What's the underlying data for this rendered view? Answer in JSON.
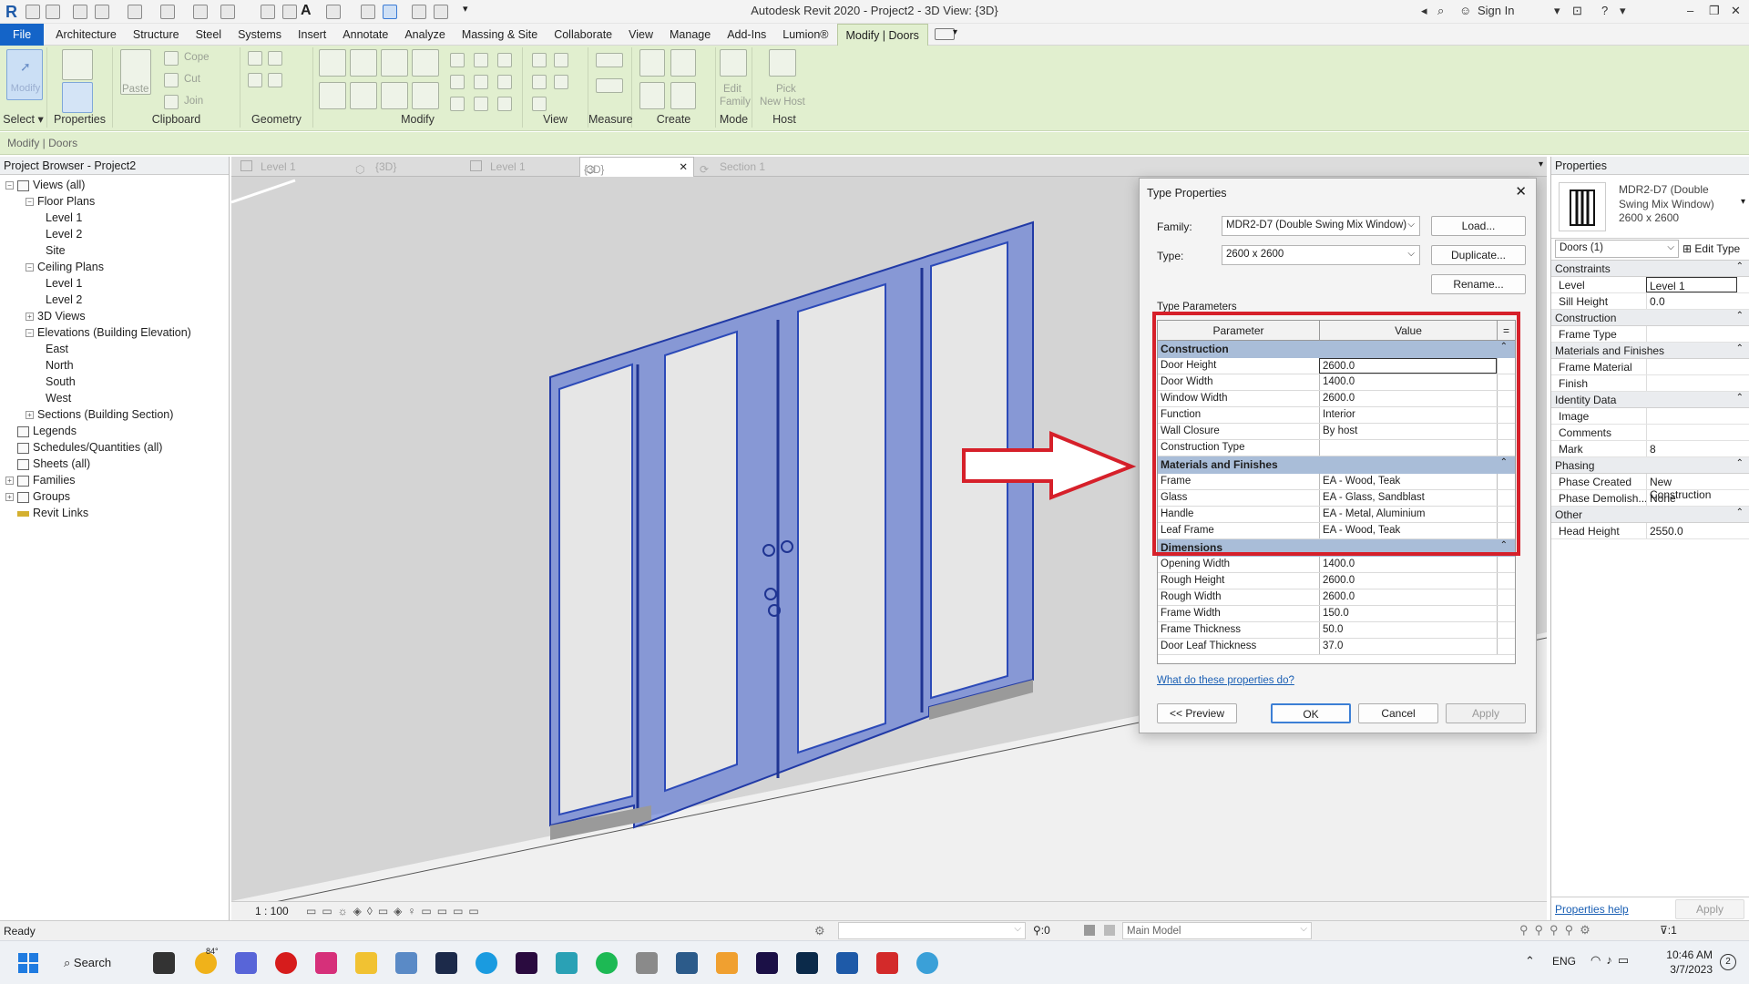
{
  "window": {
    "title": "Autodesk Revit 2020 - Project2 - 3D View: {3D}",
    "sign_in": "Sign In"
  },
  "menu": [
    "File",
    "Architecture",
    "Structure",
    "Steel",
    "Systems",
    "Insert",
    "Annotate",
    "Analyze",
    "Massing & Site",
    "Collaborate",
    "View",
    "Manage",
    "Add-Ins",
    "Lumion®",
    "Modify | Doors"
  ],
  "ribbon": {
    "groups": [
      "Select",
      "Properties",
      "Clipboard",
      "Geometry",
      "Modify",
      "View",
      "Measure",
      "Create",
      "Mode",
      "Host"
    ],
    "buttons": {
      "modify": "Modify",
      "paste": "Paste",
      "cope": "Cope",
      "cut": "Cut",
      "join": "Join",
      "edit_family_1": "Edit",
      "edit_family_2": "Family",
      "pick_host_1": "Pick",
      "pick_host_2": "New Host"
    }
  },
  "context_bar": "Modify | Doors",
  "project_browser": {
    "title": "Project Browser - Project2",
    "items": [
      {
        "label": "Views (all)",
        "level": 0,
        "toggle": "-"
      },
      {
        "label": "Floor Plans",
        "level": 1,
        "toggle": "-"
      },
      {
        "label": "Level 1",
        "level": 2
      },
      {
        "label": "Level 2",
        "level": 2
      },
      {
        "label": "Site",
        "level": 2
      },
      {
        "label": "Ceiling Plans",
        "level": 1,
        "toggle": "-"
      },
      {
        "label": "Level 1",
        "level": 2
      },
      {
        "label": "Level 2",
        "level": 2
      },
      {
        "label": "3D Views",
        "level": 1,
        "toggle": "+"
      },
      {
        "label": "Elevations (Building Elevation)",
        "level": 1,
        "toggle": "-"
      },
      {
        "label": "East",
        "level": 2
      },
      {
        "label": "North",
        "level": 2
      },
      {
        "label": "South",
        "level": 2
      },
      {
        "label": "West",
        "level": 2
      },
      {
        "label": "Sections (Building Section)",
        "level": 1,
        "toggle": "+"
      },
      {
        "label": "Legends",
        "level": 0
      },
      {
        "label": "Schedules/Quantities (all)",
        "level": 0
      },
      {
        "label": "Sheets (all)",
        "level": 0
      },
      {
        "label": "Families",
        "level": 0,
        "toggle": "+"
      },
      {
        "label": "Groups",
        "level": 0,
        "toggle": "+"
      },
      {
        "label": "Revit Links",
        "level": 0
      }
    ]
  },
  "view_tabs": [
    "Level 1",
    "{3D}",
    "Level 1",
    "{3D}",
    "Section 1"
  ],
  "view_scale": "1 : 100",
  "type_properties": {
    "title": "Type Properties",
    "family_label": "Family:",
    "family_value": "MDR2-D7 (Double Swing Mix Window)",
    "type_label": "Type:",
    "type_value": "2600 x 2600",
    "load": "Load...",
    "duplicate": "Duplicate...",
    "rename": "Rename...",
    "section": "Type Parameters",
    "col_param": "Parameter",
    "col_value": "Value",
    "col_eq": "=",
    "cat_construction": "Construction",
    "construction": [
      {
        "k": "Door Height",
        "v": "2600.0"
      },
      {
        "k": "Door Width",
        "v": "1400.0"
      },
      {
        "k": "Window Width",
        "v": "2600.0"
      },
      {
        "k": "Function",
        "v": "Interior"
      },
      {
        "k": "Wall Closure",
        "v": "By host"
      },
      {
        "k": "Construction Type",
        "v": ""
      }
    ],
    "cat_materials": "Materials and Finishes",
    "materials": [
      {
        "k": "Frame",
        "v": "EA - Wood, Teak"
      },
      {
        "k": "Glass",
        "v": "EA - Glass, Sandblast"
      },
      {
        "k": "Handle",
        "v": "EA - Metal, Aluminium"
      },
      {
        "k": "Leaf Frame",
        "v": "EA - Wood, Teak"
      }
    ],
    "cat_dimensions": "Dimensions",
    "dimensions": [
      {
        "k": "Opening Width",
        "v": "1400.0"
      },
      {
        "k": "Rough Height",
        "v": "2600.0"
      },
      {
        "k": "Rough Width",
        "v": "2600.0"
      },
      {
        "k": "Frame Width",
        "v": "150.0"
      },
      {
        "k": "Frame Thickness",
        "v": "50.0"
      },
      {
        "k": "Door Leaf Thickness",
        "v": "37.0"
      }
    ],
    "help_link": "What do these properties do?",
    "preview": "<< Preview",
    "ok": "OK",
    "cancel": "Cancel",
    "apply": "Apply"
  },
  "properties": {
    "title": "Properties",
    "type_name": "MDR2-D7 (Double Swing Mix Window)",
    "type_size": "2600 x 2600",
    "selector": "Doors (1)",
    "edit_type": "Edit Type",
    "sections": [
      {
        "name": "Constraints",
        "rows": [
          {
            "k": "Level",
            "v": "Level 1"
          },
          {
            "k": "Sill Height",
            "v": "0.0"
          }
        ]
      },
      {
        "name": "Construction",
        "rows": [
          {
            "k": "Frame Type",
            "v": ""
          }
        ]
      },
      {
        "name": "Materials and Finishes",
        "rows": [
          {
            "k": "Frame Material",
            "v": ""
          },
          {
            "k": "Finish",
            "v": ""
          }
        ]
      },
      {
        "name": "Identity Data",
        "rows": [
          {
            "k": "Image",
            "v": ""
          },
          {
            "k": "Comments",
            "v": ""
          },
          {
            "k": "Mark",
            "v": "8"
          }
        ]
      },
      {
        "name": "Phasing",
        "rows": [
          {
            "k": "Phase Created",
            "v": "New Construction"
          },
          {
            "k": "Phase Demolish...",
            "v": "None"
          }
        ]
      },
      {
        "name": "Other",
        "rows": [
          {
            "k": "Head Height",
            "v": "2550.0"
          }
        ]
      }
    ],
    "help": "Properties help",
    "apply": "Apply"
  },
  "status": {
    "ready": "Ready",
    "zero": ":0",
    "model": "Main Model",
    "filter": ":1"
  },
  "taskbar": {
    "search": "Search",
    "weather": "84°",
    "lang": "ENG",
    "time": "10:46 AM",
    "date": "3/7/2023",
    "notif": "2"
  },
  "colors": {
    "selection_blue": "#3f62d2",
    "highlight_red": "#d6202a",
    "ribbon_green": "#e1efcf",
    "file_blue": "#1464c8"
  }
}
